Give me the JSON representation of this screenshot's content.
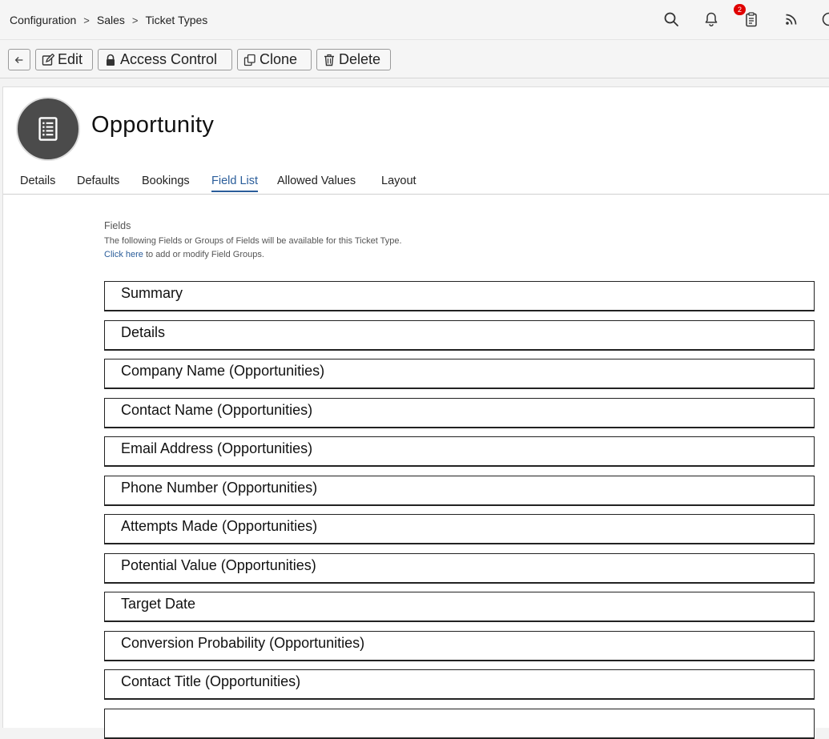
{
  "breadcrumb": {
    "items": [
      "Configuration",
      "Sales",
      "Ticket Types"
    ],
    "separator": ">"
  },
  "header_icons": [
    "search-icon",
    "bell-icon",
    "clipboard-icon",
    "rss-icon",
    "user-icon"
  ],
  "notifications": {
    "task_count": "2",
    "badge_color": "#e00000"
  },
  "toolbar": {
    "edit_label": "Edit",
    "access_control_label": "Access Control",
    "clone_label": "Clone",
    "delete_label": "Delete"
  },
  "record": {
    "title": "Opportunity",
    "icon": "document-list-icon"
  },
  "tabs": [
    {
      "label": "Details",
      "active": false
    },
    {
      "label": "Defaults",
      "active": false
    },
    {
      "label": "Bookings",
      "active": false
    },
    {
      "label": "Field List",
      "active": true
    },
    {
      "label": "Allowed Values",
      "active": false
    },
    {
      "label": "Layout",
      "active": false
    }
  ],
  "fields_section": {
    "heading": "Fields",
    "description": "The following Fields or Groups of Fields will be available for this Ticket Type.",
    "link_text": "Click here",
    "link_suffix": " to add or modify Field Groups.",
    "items": [
      "Summary",
      "Details",
      "Company Name (Opportunities)",
      "Contact Name (Opportunities)",
      "Email Address (Opportunities)",
      "Phone Number (Opportunities)",
      "Attempts Made (Opportunities)",
      "Potential Value (Opportunities)",
      "Target Date",
      "Conversion Probability (Opportunities)",
      "Contact Title (Opportunities)"
    ]
  },
  "colors": {
    "accent": "#2a5d9a",
    "avatar_bg": "#4b4b4b"
  }
}
